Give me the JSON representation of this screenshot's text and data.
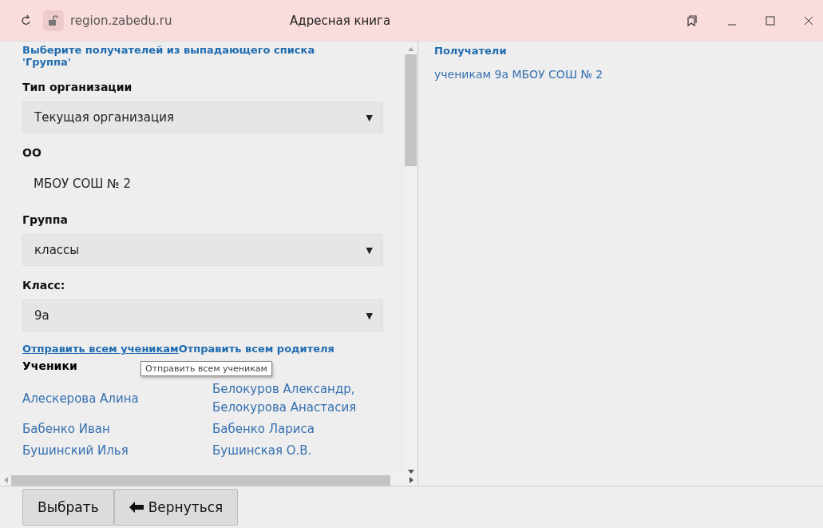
{
  "window": {
    "url": "region.zabedu.ru",
    "title": "Адресная книга"
  },
  "form": {
    "instruction": "Выберите получателей из выпадающего списка 'Группа'",
    "fields": [
      {
        "kind": "select",
        "label": "Тип организации",
        "value": "Текущая организация",
        "arrow": "▼"
      },
      {
        "kind": "static",
        "label": "ОО",
        "value": "МБОУ СОШ № 2"
      },
      {
        "kind": "select",
        "label": "Группа",
        "value": "классы",
        "arrow": "▼"
      },
      {
        "kind": "select",
        "label": "Класс:",
        "value": "9а",
        "arrow": "▼"
      }
    ],
    "send_students": "Отправить всем ученикам",
    "send_parents": "Отправить всем родителя",
    "students_heading": "Ученики",
    "students": [
      "Алескерова Алина",
      "Бабенко Иван",
      "Бушинский Илья"
    ],
    "parents": [
      [
        "Белокуров Александр,",
        "Белокурова Анастасия"
      ],
      [
        "Бабенко Лариса"
      ],
      [
        "Бушинская О.В."
      ]
    ],
    "tooltip": "Отправить всем ученикам"
  },
  "recipients": {
    "heading": "Получатели",
    "items": [
      "ученикам 9а МБОУ СОШ № 2"
    ]
  },
  "buttons": [
    {
      "kind": "plain",
      "label": "Выбрать"
    },
    {
      "kind": "back",
      "label": "Вернуться"
    }
  ]
}
